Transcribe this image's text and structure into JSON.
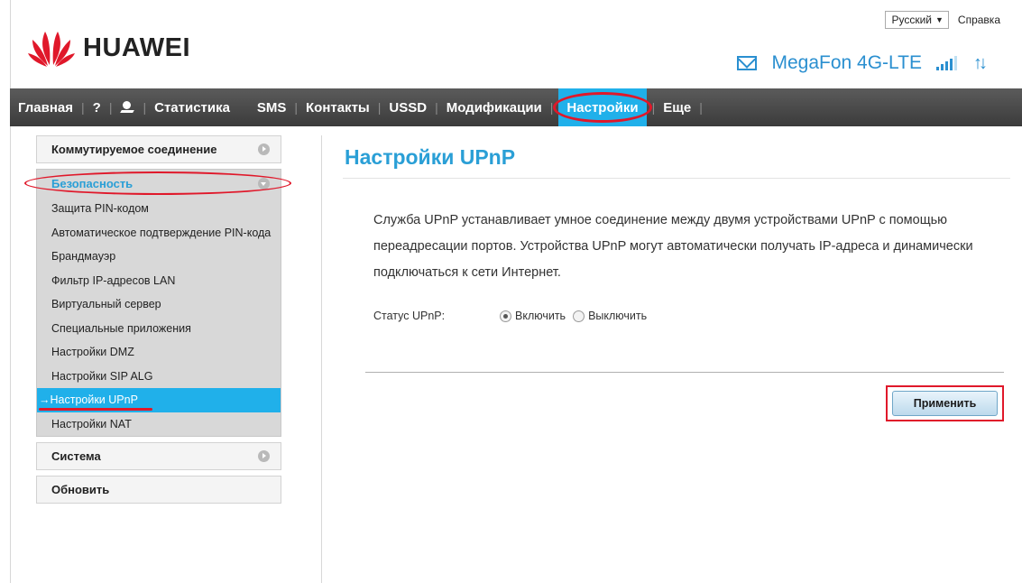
{
  "header": {
    "language": "Русский",
    "help": "Справка",
    "logo_text": "HUAWEI",
    "operator": "MegaFon 4G-LTE",
    "brand_color": "#e0182a",
    "accent_color": "#20b0ea"
  },
  "nav": {
    "items": [
      {
        "label": "Главная"
      },
      {
        "label": "?"
      },
      {
        "label": ""
      },
      {
        "label": "Статистика"
      },
      {
        "label": "SMS"
      },
      {
        "label": "Контакты"
      },
      {
        "label": "USSD"
      },
      {
        "label": "Модификации"
      },
      {
        "label": "Настройки"
      },
      {
        "label": "Еще"
      }
    ],
    "active": "Настройки"
  },
  "sidebar": {
    "dialup": "Коммутируемое соединение",
    "security": "Безопасность",
    "security_items": [
      "Защита PIN-кодом",
      "Автоматическое подтверждение PIN-кода",
      "Брандмауэр",
      "Фильтр IP-адресов LAN",
      "Виртуальный сервер",
      "Специальные приложения",
      "Настройки DMZ",
      "Настройки SIP ALG",
      "→Настройки UPnP",
      "Настройки NAT"
    ],
    "system": "Система",
    "update": "Обновить"
  },
  "main": {
    "title": "Настройки UPnP",
    "description": "Служба UPnP устанавливает умное соединение между двумя устройствами UPnP с помощью переадресации портов. Устройства UPnP могут автоматически получать IP-адреса и динамически подключаться к сети Интернет.",
    "status_label": "Статус UPnP:",
    "option_enable": "Включить",
    "option_disable": "Выключить",
    "status_value": "Включить",
    "apply_button": "Применить"
  }
}
